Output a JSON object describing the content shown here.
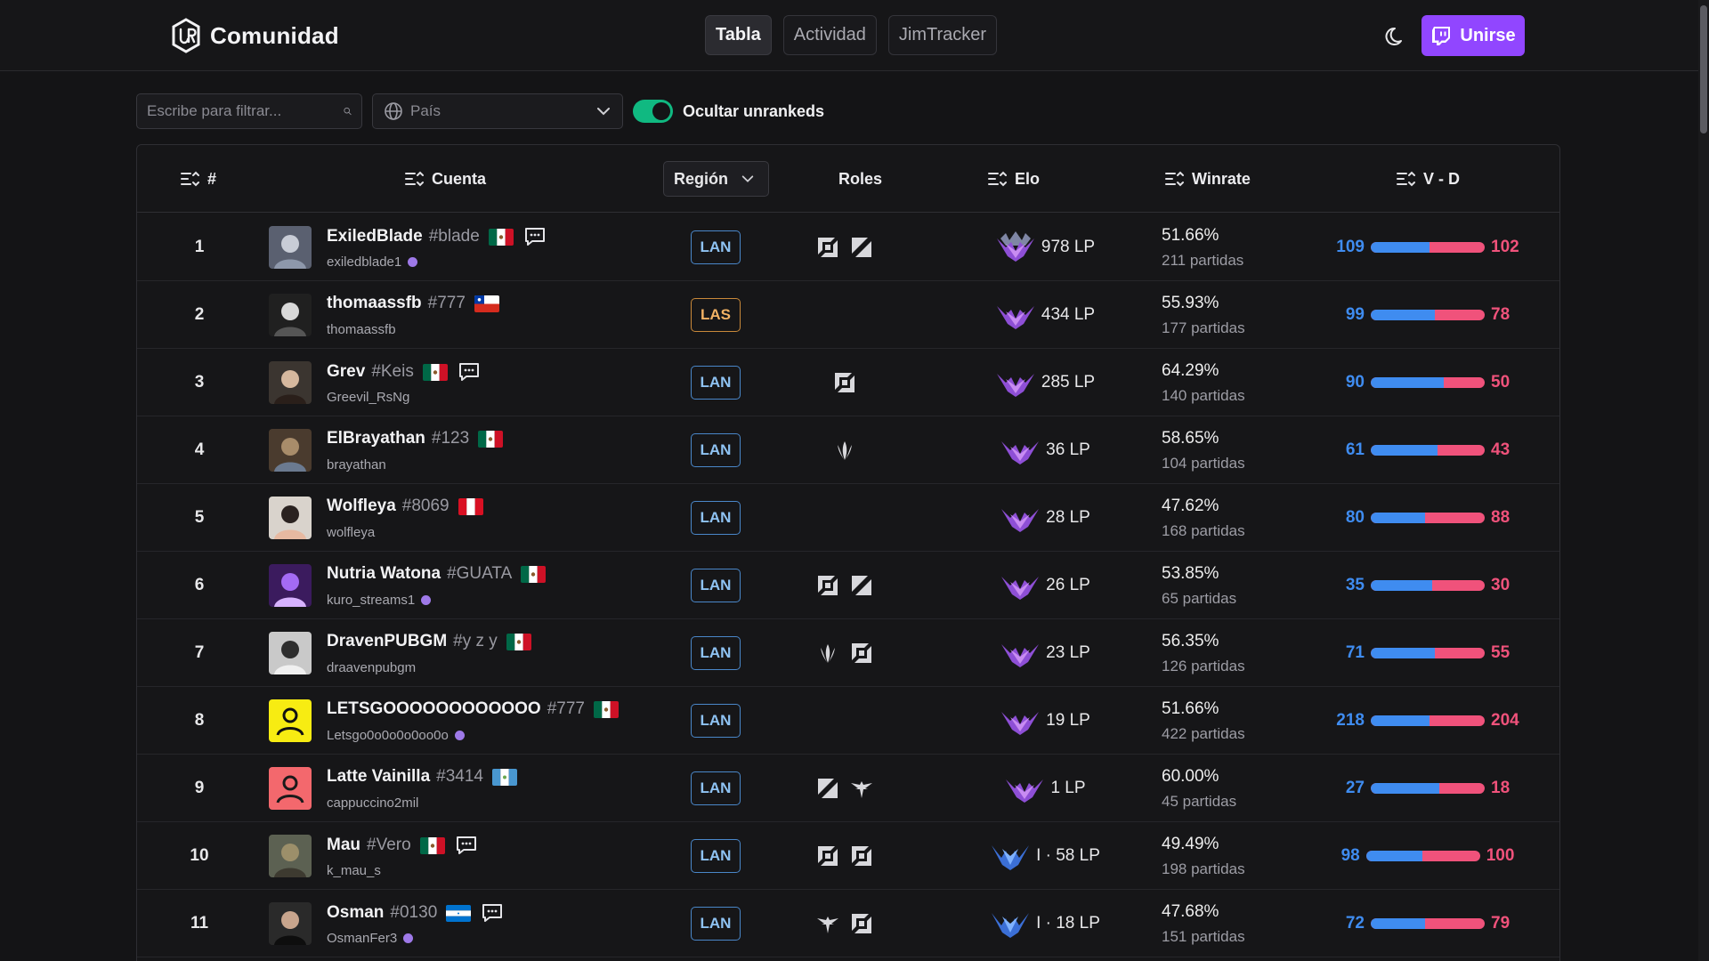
{
  "header": {
    "brand": "Comunidad",
    "nav": [
      {
        "label": "Tabla",
        "active": true
      },
      {
        "label": "Actividad",
        "active": false
      },
      {
        "label": "JimTracker",
        "active": false
      }
    ],
    "join_label": "Unirse",
    "join_color": "#9146ff"
  },
  "filters": {
    "search_placeholder": "Escribe para filtrar...",
    "country_placeholder": "País",
    "toggle_label": "Ocultar unrankeds",
    "toggle_on": true
  },
  "columns": {
    "rank": "#",
    "account": "Cuenta",
    "region": "Región",
    "roles": "Roles",
    "elo": "Elo",
    "winrate": "Winrate",
    "vd": "V - D"
  },
  "colors": {
    "win": "#3f8cf0",
    "loss": "#f0527b",
    "lan": "#4a87c9",
    "las": "#c9893a",
    "master": "#a855f7",
    "grandmaster_blue": "#3b6fd6"
  },
  "rows": [
    {
      "rank": "1",
      "name": "ExiledBlade",
      "tag": "#blade",
      "flag": "mx",
      "chat": true,
      "sub": "exiledblade1",
      "live": true,
      "region": "LAN",
      "roles": [
        "top-icon",
        "jungle-icon"
      ],
      "elo": "978 LP",
      "tier": "master-gold",
      "wr": "51.66%",
      "games": "211 partidas",
      "w": "109",
      "l": "102",
      "avatar": "a1"
    },
    {
      "rank": "2",
      "name": "thomaassfb",
      "tag": "#777",
      "flag": "cl",
      "chat": false,
      "sub": "thomaassfb",
      "live": false,
      "region": "LAS",
      "roles": [],
      "elo": "434 LP",
      "tier": "master",
      "wr": "55.93%",
      "games": "177 partidas",
      "w": "99",
      "l": "78",
      "avatar": "a2"
    },
    {
      "rank": "3",
      "name": "Grev",
      "tag": "#Keis",
      "flag": "mx",
      "chat": true,
      "sub": "Greevil_RsNg",
      "live": false,
      "region": "LAN",
      "roles": [
        "top-icon"
      ],
      "elo": "285 LP",
      "tier": "master",
      "wr": "64.29%",
      "games": "140 partidas",
      "w": "90",
      "l": "50",
      "avatar": "a3"
    },
    {
      "rank": "4",
      "name": "ElBrayathan",
      "tag": "#123",
      "flag": "mx",
      "chat": false,
      "sub": "brayathan",
      "live": false,
      "region": "LAN",
      "roles": [
        "mid-icon"
      ],
      "elo": "36 LP",
      "tier": "master",
      "wr": "58.65%",
      "games": "104 partidas",
      "w": "61",
      "l": "43",
      "avatar": "a4"
    },
    {
      "rank": "5",
      "name": "Wolfleya",
      "tag": "#8069",
      "flag": "pe",
      "chat": false,
      "sub": "wolfleya",
      "live": false,
      "region": "LAN",
      "roles": [],
      "elo": "28 LP",
      "tier": "master",
      "wr": "47.62%",
      "games": "168 partidas",
      "w": "80",
      "l": "88",
      "avatar": "a5"
    },
    {
      "rank": "6",
      "name": "Nutria Watona",
      "tag": "#GUATA",
      "flag": "mx",
      "chat": false,
      "sub": "kuro_streams1",
      "live": true,
      "region": "LAN",
      "roles": [
        "top-icon",
        "jungle-icon"
      ],
      "elo": "26 LP",
      "tier": "master",
      "wr": "53.85%",
      "games": "65 partidas",
      "w": "35",
      "l": "30",
      "avatar": "a6"
    },
    {
      "rank": "7",
      "name": "DravenPUBGM",
      "tag": "#y z y",
      "flag": "mx",
      "chat": false,
      "sub": "draavenpubgm",
      "live": false,
      "region": "LAN",
      "roles": [
        "mid-icon",
        "top-icon"
      ],
      "elo": "23 LP",
      "tier": "master",
      "wr": "56.35%",
      "games": "126 partidas",
      "w": "71",
      "l": "55",
      "avatar": "a7"
    },
    {
      "rank": "8",
      "name": "LETSGOOOOOOOOOOOO",
      "tag": "#777",
      "flag": "mx",
      "chat": false,
      "sub": "Letsgo0o0o0o0oo0o",
      "live": true,
      "region": "LAN",
      "roles": [],
      "elo": "19 LP",
      "tier": "master",
      "wr": "51.66%",
      "games": "422 partidas",
      "w": "218",
      "l": "204",
      "avatar": "a8"
    },
    {
      "rank": "9",
      "name": "Latte Vainilla",
      "tag": "#3414",
      "flag": "gt",
      "chat": false,
      "sub": "cappuccino2mil",
      "live": false,
      "region": "LAN",
      "roles": [
        "jungle-icon",
        "support-icon"
      ],
      "elo": "1 LP",
      "tier": "master",
      "wr": "60.00%",
      "games": "45 partidas",
      "w": "27",
      "l": "18",
      "avatar": "a9"
    },
    {
      "rank": "10",
      "name": "Mau",
      "tag": "#Vero",
      "flag": "mx",
      "chat": true,
      "sub": "k_mau_s",
      "live": false,
      "region": "LAN",
      "roles": [
        "top-icon",
        "top-icon"
      ],
      "elo": "I · 58 LP",
      "tier": "diamond",
      "wr": "49.49%",
      "games": "198 partidas",
      "w": "98",
      "l": "100",
      "avatar": "a10"
    },
    {
      "rank": "11",
      "name": "Osman",
      "tag": "#0130",
      "flag": "hn",
      "chat": true,
      "sub": "OsmanFer3",
      "live": true,
      "region": "LAN",
      "roles": [
        "support-icon",
        "top-icon"
      ],
      "elo": "I · 18 LP",
      "tier": "diamond",
      "wr": "47.68%",
      "games": "151 partidas",
      "w": "72",
      "l": "79",
      "avatar": "a11"
    }
  ]
}
